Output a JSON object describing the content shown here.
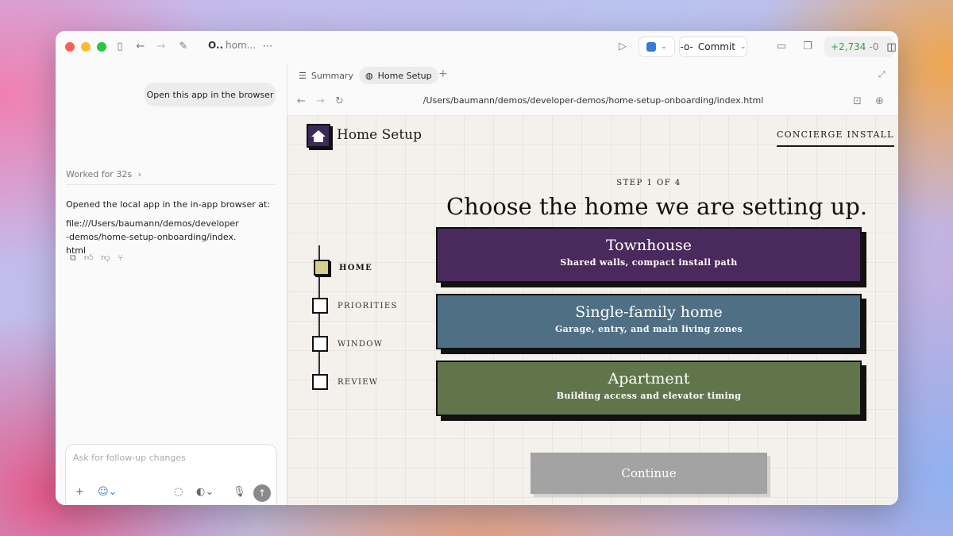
{
  "titlebar": {
    "title_short": "O..",
    "title_sub": "hom...",
    "commit_label": "Commit",
    "diff_added": "+2,734",
    "diff_removed": "-0"
  },
  "chat": {
    "user_message": "Open this app in the browser",
    "worked_label": "Worked for 32s",
    "response_line1": "Opened the local app in the in-app browser at:",
    "response_line2": "file:///Users/baumann/demos/developer-demos/home-setup-onboarding/index.html",
    "composer_placeholder": "Ask for follow-up changes"
  },
  "browser": {
    "tabs": [
      {
        "label": "Summary",
        "icon": "list-icon"
      },
      {
        "label": "Home Setup",
        "icon": "globe-icon"
      }
    ],
    "url": "/Users/baumann/demos/developer-demos/home-setup-onboarding/index.html"
  },
  "app": {
    "brand": "Home Setup",
    "concierge_link": "CONCIERGE INSTALL",
    "step_label": "STEP 1 OF 4",
    "headline": "Choose the home we are setting up.",
    "steps": [
      {
        "label": "HOME",
        "active": true
      },
      {
        "label": "PRIORITIES",
        "active": false
      },
      {
        "label": "WINDOW",
        "active": false
      },
      {
        "label": "REVIEW",
        "active": false
      }
    ],
    "options": [
      {
        "title": "Townhouse",
        "subtitle": "Shared walls, compact install path",
        "color": "#4a2a5c"
      },
      {
        "title": "Single-family home",
        "subtitle": "Garage, entry, and main living zones",
        "color": "#4f6f85"
      },
      {
        "title": "Apartment",
        "subtitle": "Building access and elevator timing",
        "color": "#60764a"
      }
    ],
    "continue_label": "Continue"
  },
  "colors": {
    "accent_step": "#d6d08a",
    "viewport_bg": "#f4f1ec",
    "continue_disabled": "#a3a3a3"
  }
}
